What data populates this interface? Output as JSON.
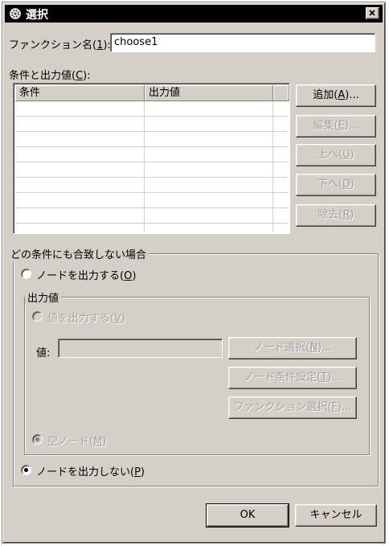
{
  "window": {
    "title": "選択",
    "close_symbol": "✕"
  },
  "function_name": {
    "label_prefix": "ファンクション名(",
    "label_key": "1",
    "label_suffix": "):",
    "value": "choose1"
  },
  "conditions": {
    "label_prefix": "条件と出力値(",
    "label_key": "C",
    "label_suffix": "):",
    "columns": [
      "条件",
      "出力値"
    ],
    "rows": []
  },
  "side_buttons": {
    "add": {
      "prefix": "追加(",
      "key": "A",
      "suffix": ")..."
    },
    "edit": {
      "prefix": "編集(",
      "key": "E",
      "suffix": ")..."
    },
    "up": {
      "prefix": "上へ(",
      "key": "U",
      "suffix": ")"
    },
    "down": {
      "prefix": "下へ(",
      "key": "D",
      "suffix": ")"
    },
    "remove": {
      "prefix": "除去(",
      "key": "R",
      "suffix": ")"
    }
  },
  "no_match": {
    "group_title": "どの条件にも合致しない場合",
    "output_node": {
      "prefix": "ノードを出力する(",
      "key": "O",
      "suffix": ")",
      "selected": false
    },
    "output_value_group": {
      "title": "出力値",
      "output_value_radio": {
        "prefix": "値を出力する(",
        "key": "V",
        "suffix": ")"
      },
      "value_label": "値:",
      "value_field": "",
      "node_select": {
        "prefix": "ノード選択(",
        "key": "N",
        "suffix": ")..."
      },
      "node_condition": {
        "prefix": "ノード条件設定(",
        "key": "T",
        "suffix": ")..."
      },
      "function_select": {
        "prefix": "ファンクション選択(",
        "key": "F",
        "suffix": ")..."
      },
      "empty_node_radio": {
        "prefix": "空ノード(",
        "key": "M",
        "suffix": ")"
      }
    },
    "no_output": {
      "prefix": "ノードを出力しない(",
      "key": "P",
      "suffix": ")",
      "selected": true
    }
  },
  "footer": {
    "ok": "OK",
    "cancel": "キャンセル"
  }
}
